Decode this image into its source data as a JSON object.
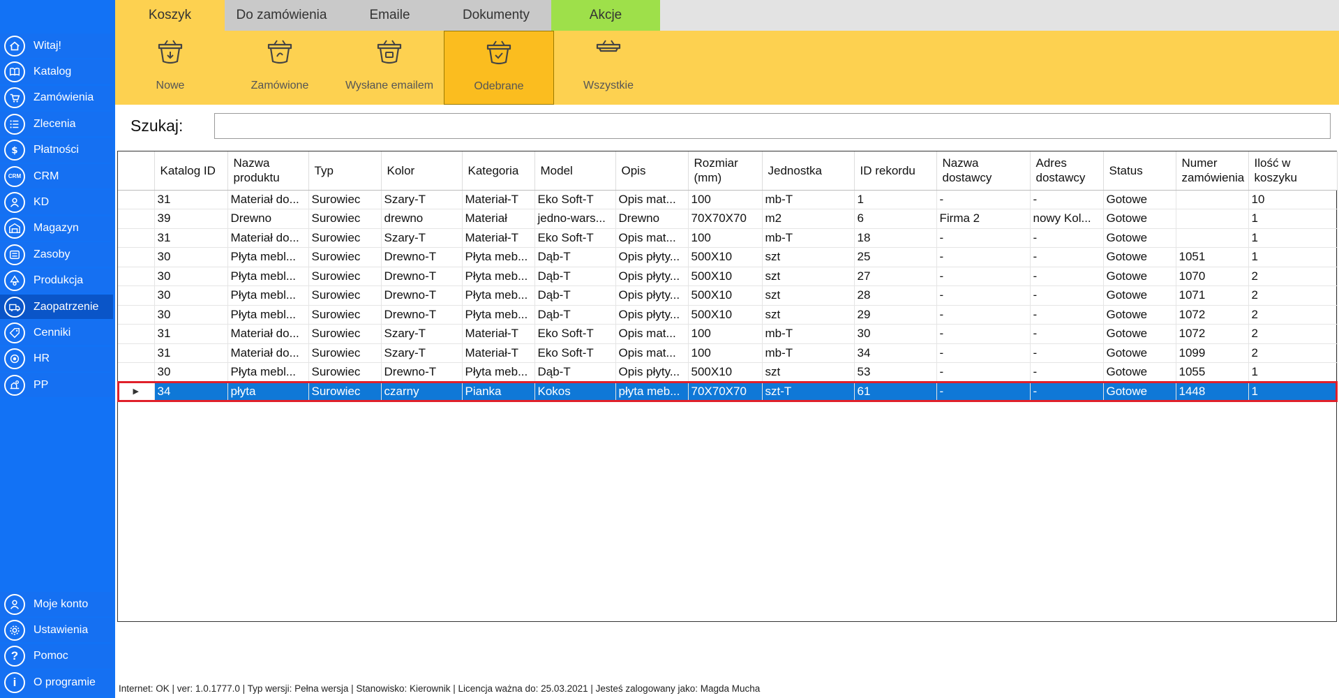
{
  "sidebar": {
    "items": [
      {
        "label": "Witaj!",
        "icon": "home-icon"
      },
      {
        "label": "Katalog",
        "icon": "book-icon"
      },
      {
        "label": "Zamówienia",
        "icon": "cart-icon"
      },
      {
        "label": "Zlecenia",
        "icon": "list-icon"
      },
      {
        "label": "Płatności",
        "icon": "dollar-icon"
      },
      {
        "label": "CRM",
        "icon": "crm-icon",
        "glyph": "CRM"
      },
      {
        "label": "KD",
        "icon": "person-icon"
      },
      {
        "label": "Magazyn",
        "icon": "warehouse-icon"
      },
      {
        "label": "Zasoby",
        "icon": "resources-icon"
      },
      {
        "label": "Produkcja",
        "icon": "production-icon"
      },
      {
        "label": "Zaopatrzenie",
        "icon": "truck-icon",
        "active": true
      },
      {
        "label": "Cenniki",
        "icon": "tag-icon"
      },
      {
        "label": "HR",
        "icon": "hr-icon"
      },
      {
        "label": "PP",
        "icon": "pp-icon"
      }
    ],
    "bottom_items": [
      {
        "label": "Moje konto",
        "icon": "account-icon"
      },
      {
        "label": "Ustawienia",
        "icon": "gear-icon"
      },
      {
        "label": "Pomoc",
        "icon": "help-icon",
        "glyph": "?"
      },
      {
        "label": "O programie",
        "icon": "info-icon",
        "glyph": "i"
      }
    ]
  },
  "tabs": [
    {
      "label": "Koszyk",
      "color": "#fdd150"
    },
    {
      "label": "Do zamówienia",
      "color": "#c9c9c9"
    },
    {
      "label": "Emaile",
      "color": "#c9c9c9"
    },
    {
      "label": "Dokumenty",
      "color": "#c9c9c9"
    },
    {
      "label": "Akcje",
      "color": "#9ee04a"
    }
  ],
  "ribbon": {
    "buttons": [
      {
        "label": "Nowe",
        "icon": "basket-download-icon"
      },
      {
        "label": "Zamówione",
        "icon": "basket-order-icon"
      },
      {
        "label": "Wysłane emailem",
        "icon": "basket-email-icon"
      },
      {
        "label": "Odebrane",
        "icon": "basket-check-icon",
        "active": true
      },
      {
        "label": "Wszystkie",
        "icon": "basket-icon"
      }
    ]
  },
  "search": {
    "label": "Szukaj:",
    "value": "",
    "placeholder": ""
  },
  "grid": {
    "columns": [
      "Katalog ID",
      "Nazwa produktu",
      "Typ",
      "Kolor",
      "Kategoria",
      "Model",
      "Opis",
      "Rozmiar (mm)",
      "Jednostka",
      "ID rekordu",
      "Nazwa dostawcy",
      "Adres dostawcy",
      "Status",
      "Numer zamówienia",
      "Ilość w koszyku"
    ],
    "rows": [
      [
        "31",
        "Materiał do...",
        "Surowiec",
        "Szary-T",
        "Materiał-T",
        "Eko Soft-T",
        "Opis mat...",
        "100",
        "mb-T",
        "1",
        "-",
        "-",
        "Gotowe",
        "",
        "10"
      ],
      [
        "39",
        "Drewno",
        "Surowiec",
        "drewno",
        "Materiał",
        "jedno-wars...",
        "Drewno",
        "70X70X70",
        "m2",
        "6",
        "Firma 2",
        "nowy Kol...",
        "Gotowe",
        "",
        "1"
      ],
      [
        "31",
        "Materiał do...",
        "Surowiec",
        "Szary-T",
        "Materiał-T",
        "Eko Soft-T",
        "Opis mat...",
        "100",
        "mb-T",
        "18",
        "-",
        "-",
        "Gotowe",
        "",
        "1"
      ],
      [
        "30",
        "Płyta mebl...",
        "Surowiec",
        "Drewno-T",
        "Płyta meb...",
        "Dąb-T",
        "Opis płyty...",
        "500X10",
        "szt",
        "25",
        "-",
        "-",
        "Gotowe",
        "1051",
        "1"
      ],
      [
        "30",
        "Płyta mebl...",
        "Surowiec",
        "Drewno-T",
        "Płyta meb...",
        "Dąb-T",
        "Opis płyty...",
        "500X10",
        "szt",
        "27",
        "-",
        "-",
        "Gotowe",
        "1070",
        "2"
      ],
      [
        "30",
        "Płyta mebl...",
        "Surowiec",
        "Drewno-T",
        "Płyta meb...",
        "Dąb-T",
        "Opis płyty...",
        "500X10",
        "szt",
        "28",
        "-",
        "-",
        "Gotowe",
        "1071",
        "2"
      ],
      [
        "30",
        "Płyta mebl...",
        "Surowiec",
        "Drewno-T",
        "Płyta meb...",
        "Dąb-T",
        "Opis płyty...",
        "500X10",
        "szt",
        "29",
        "-",
        "-",
        "Gotowe",
        "1072",
        "2"
      ],
      [
        "31",
        "Materiał do...",
        "Surowiec",
        "Szary-T",
        "Materiał-T",
        "Eko Soft-T",
        "Opis mat...",
        "100",
        "mb-T",
        "30",
        "-",
        "-",
        "Gotowe",
        "1072",
        "2"
      ],
      [
        "31",
        "Materiał do...",
        "Surowiec",
        "Szary-T",
        "Materiał-T",
        "Eko Soft-T",
        "Opis mat...",
        "100",
        "mb-T",
        "34",
        "-",
        "-",
        "Gotowe",
        "1099",
        "2"
      ],
      [
        "30",
        "Płyta mebl...",
        "Surowiec",
        "Drewno-T",
        "Płyta meb...",
        "Dąb-T",
        "Opis płyty...",
        "500X10",
        "szt",
        "53",
        "-",
        "-",
        "Gotowe",
        "1055",
        "1"
      ],
      [
        "34",
        "płyta",
        "Surowiec",
        "czarny",
        "Pianka",
        "Kokos",
        "płyta meb...",
        "70X70X70",
        "szt-T",
        "61",
        "-",
        "-",
        "Gotowe",
        "1448",
        "1"
      ]
    ],
    "selected_row": 10,
    "row_marker": "▶"
  },
  "statusbar": {
    "text": "Internet: OK  |   ver: 1.0.1777.0   |   Typ wersji: Pełna wersja   |   Stanowisko: Kierownik   |   Licencja ważna do: 25.03.2021   |   Jesteś zalogowany jako: Magda Mucha"
  }
}
